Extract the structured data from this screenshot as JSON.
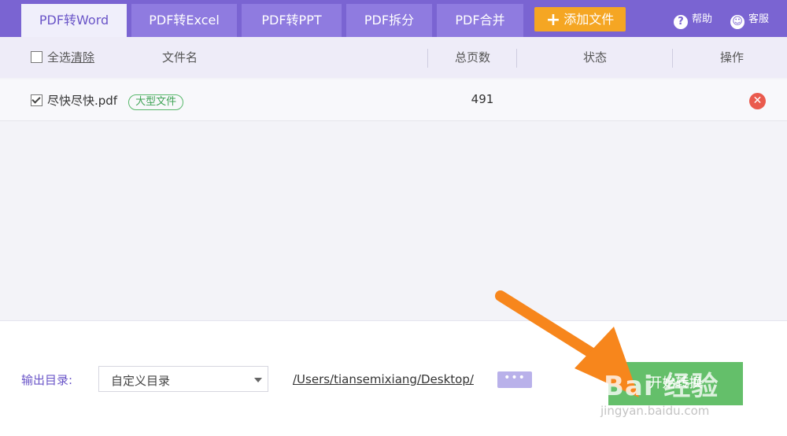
{
  "tabs": [
    {
      "label": "PDF转Word",
      "active": true
    },
    {
      "label": "PDF转Excel",
      "active": false
    },
    {
      "label": "PDF转PPT",
      "active": false
    },
    {
      "label": "PDF拆分",
      "active": false
    },
    {
      "label": "PDF合并",
      "active": false
    }
  ],
  "toolbar": {
    "add_file_label": "添加文件",
    "help_label": "帮助",
    "service_label": "客服"
  },
  "table": {
    "select_all_label": "全选",
    "clear_label": "清除",
    "columns": {
      "filename": "文件名",
      "pages": "总页数",
      "status": "状态",
      "action": "操作"
    },
    "rows": [
      {
        "checked": true,
        "filename": "尽快尽快.pdf",
        "badge": "大型文件",
        "pages": "491",
        "status": ""
      }
    ]
  },
  "footer": {
    "output_label": "输出目录:",
    "dir_select_value": "自定义目录",
    "path": "/Users/tiansemixiang/Desktop/",
    "more_label": "•••",
    "start_label": "开始转换"
  },
  "watermark": {
    "brand": "Bai 经验",
    "site": "jingyan.baidu.com"
  },
  "colors": {
    "accent": "#7a64d2",
    "add_button": "#f5a623",
    "start_button": "#64bf6a",
    "delete": "#ea5a4d",
    "annotation_arrow": "#f7861c"
  }
}
